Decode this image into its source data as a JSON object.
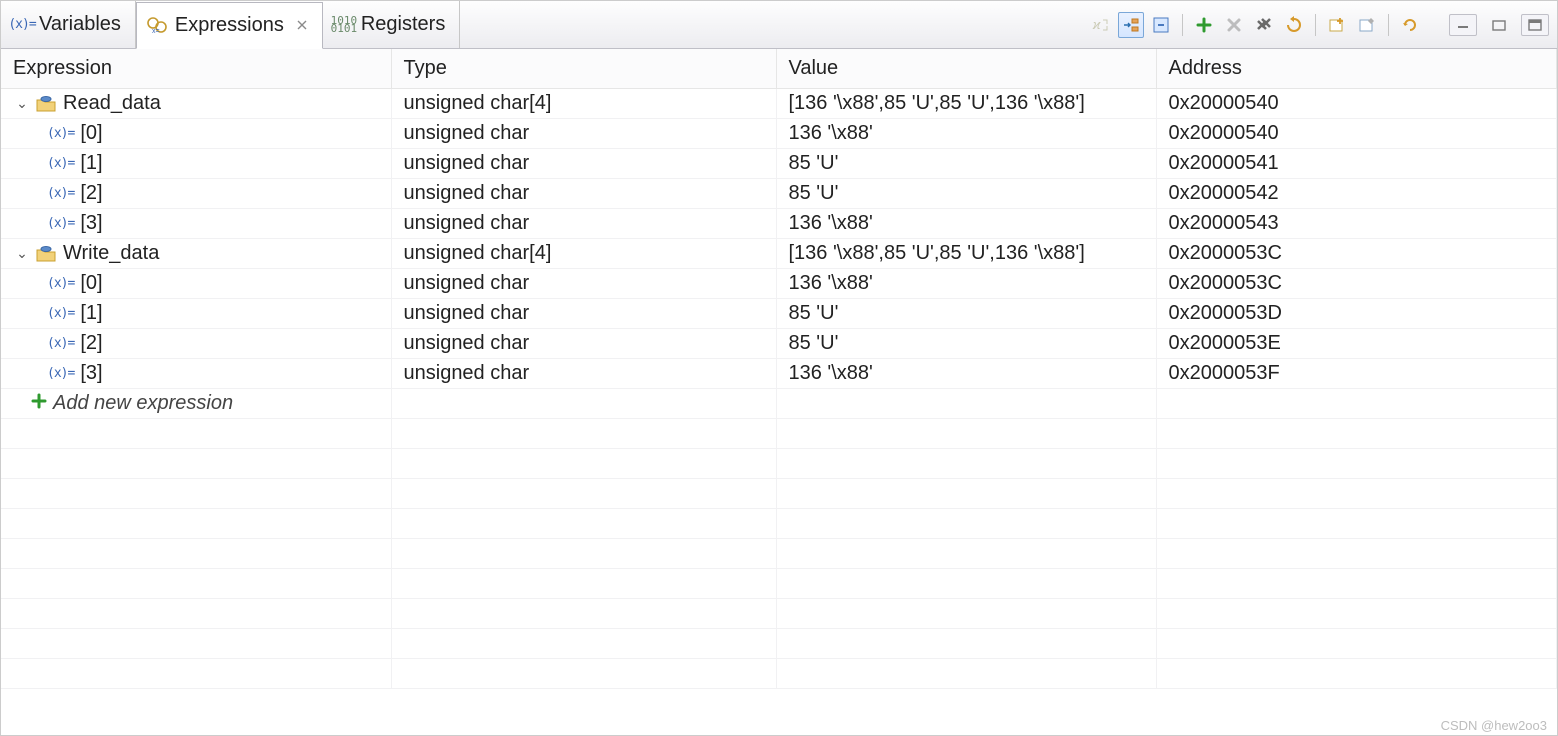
{
  "tabs": {
    "variables": "Variables",
    "expressions": "Expressions",
    "registers": "Registers"
  },
  "columns": {
    "expression": "Expression",
    "type": "Type",
    "value": "Value",
    "address": "Address"
  },
  "rows": [
    {
      "kind": "parent",
      "name": "Read_data",
      "type": "unsigned char[4]",
      "value": "[136 '\\x88',85 'U',85 'U',136 '\\x88']",
      "address": "0x20000540"
    },
    {
      "kind": "child",
      "name": "[0]",
      "type": "unsigned char",
      "value": "136 '\\x88'",
      "address": "0x20000540"
    },
    {
      "kind": "child",
      "name": "[1]",
      "type": "unsigned char",
      "value": "85 'U'",
      "address": "0x20000541"
    },
    {
      "kind": "child",
      "name": "[2]",
      "type": "unsigned char",
      "value": "85 'U'",
      "address": "0x20000542"
    },
    {
      "kind": "child",
      "name": "[3]",
      "type": "unsigned char",
      "value": "136 '\\x88'",
      "address": "0x20000543"
    },
    {
      "kind": "parent",
      "name": "Write_data",
      "type": "unsigned char[4]",
      "value": "[136 '\\x88',85 'U',85 'U',136 '\\x88']",
      "address": "0x2000053C"
    },
    {
      "kind": "child",
      "name": "[0]",
      "type": "unsigned char",
      "value": "136 '\\x88'",
      "address": "0x2000053C"
    },
    {
      "kind": "child",
      "name": "[1]",
      "type": "unsigned char",
      "value": "85 'U'",
      "address": "0x2000053D"
    },
    {
      "kind": "child",
      "name": "[2]",
      "type": "unsigned char",
      "value": "85 'U'",
      "address": "0x2000053E"
    },
    {
      "kind": "child",
      "name": "[3]",
      "type": "unsigned char",
      "value": "136 '\\x88'",
      "address": "0x2000053F"
    }
  ],
  "add_new": "Add new expression",
  "watermark": "CSDN @hew2oo3",
  "blank_rows": 9
}
